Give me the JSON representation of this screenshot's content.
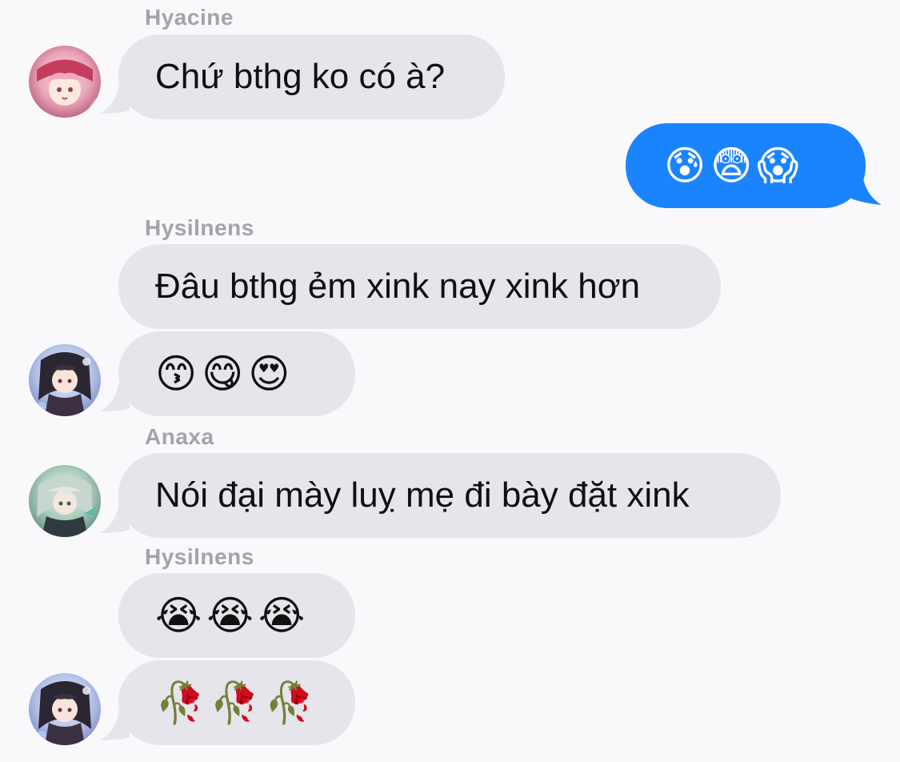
{
  "colors": {
    "background": "#f9f9fb",
    "incoming_bubble": "#e6e5eb",
    "outgoing_bubble": "#1a84ff",
    "sender_name": "#a3a3a8"
  },
  "messages": [
    {
      "sender": "Hyacine",
      "text": "Chứ bthg ko có à?",
      "direction": "incoming",
      "avatar": "avatar-hyacine"
    },
    {
      "sender": "",
      "text": "😰😨😱",
      "direction": "outgoing"
    },
    {
      "sender": "Hysilnens",
      "text": "Đâu bthg ẻm xink nay xink hơn",
      "direction": "incoming"
    },
    {
      "sender": "",
      "text": "😙😋😍",
      "direction": "incoming",
      "avatar": "avatar-hysilnens"
    },
    {
      "sender": "Anaxa",
      "text": "Nói đại mày luỵ mẹ đi bày đặt xink",
      "direction": "incoming",
      "avatar": "avatar-anaxa"
    },
    {
      "sender": "Hysilnens",
      "text": "😭😭😭",
      "direction": "incoming"
    },
    {
      "sender": "",
      "text": "🥀🥀🥀",
      "direction": "incoming",
      "avatar": "avatar-hysilnens"
    }
  ]
}
